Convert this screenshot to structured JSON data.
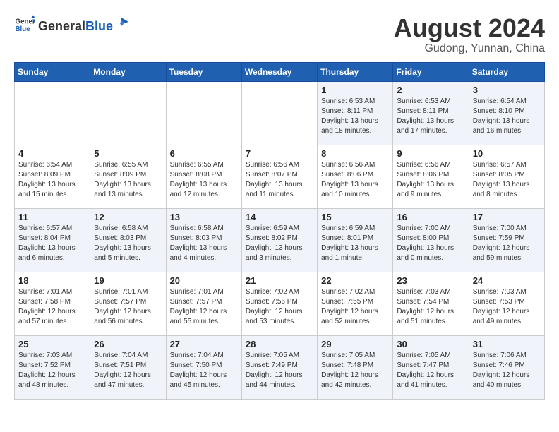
{
  "header": {
    "logo_general": "General",
    "logo_blue": "Blue",
    "title": "August 2024",
    "subtitle": "Gudong, Yunnan, China"
  },
  "days_of_week": [
    "Sunday",
    "Monday",
    "Tuesday",
    "Wednesday",
    "Thursday",
    "Friday",
    "Saturday"
  ],
  "weeks": [
    [
      {
        "day": "",
        "info": ""
      },
      {
        "day": "",
        "info": ""
      },
      {
        "day": "",
        "info": ""
      },
      {
        "day": "",
        "info": ""
      },
      {
        "day": "1",
        "info": "Sunrise: 6:53 AM\nSunset: 8:11 PM\nDaylight: 13 hours\nand 18 minutes."
      },
      {
        "day": "2",
        "info": "Sunrise: 6:53 AM\nSunset: 8:11 PM\nDaylight: 13 hours\nand 17 minutes."
      },
      {
        "day": "3",
        "info": "Sunrise: 6:54 AM\nSunset: 8:10 PM\nDaylight: 13 hours\nand 16 minutes."
      }
    ],
    [
      {
        "day": "4",
        "info": "Sunrise: 6:54 AM\nSunset: 8:09 PM\nDaylight: 13 hours\nand 15 minutes."
      },
      {
        "day": "5",
        "info": "Sunrise: 6:55 AM\nSunset: 8:09 PM\nDaylight: 13 hours\nand 13 minutes."
      },
      {
        "day": "6",
        "info": "Sunrise: 6:55 AM\nSunset: 8:08 PM\nDaylight: 13 hours\nand 12 minutes."
      },
      {
        "day": "7",
        "info": "Sunrise: 6:56 AM\nSunset: 8:07 PM\nDaylight: 13 hours\nand 11 minutes."
      },
      {
        "day": "8",
        "info": "Sunrise: 6:56 AM\nSunset: 8:06 PM\nDaylight: 13 hours\nand 10 minutes."
      },
      {
        "day": "9",
        "info": "Sunrise: 6:56 AM\nSunset: 8:06 PM\nDaylight: 13 hours\nand 9 minutes."
      },
      {
        "day": "10",
        "info": "Sunrise: 6:57 AM\nSunset: 8:05 PM\nDaylight: 13 hours\nand 8 minutes."
      }
    ],
    [
      {
        "day": "11",
        "info": "Sunrise: 6:57 AM\nSunset: 8:04 PM\nDaylight: 13 hours\nand 6 minutes."
      },
      {
        "day": "12",
        "info": "Sunrise: 6:58 AM\nSunset: 8:03 PM\nDaylight: 13 hours\nand 5 minutes."
      },
      {
        "day": "13",
        "info": "Sunrise: 6:58 AM\nSunset: 8:03 PM\nDaylight: 13 hours\nand 4 minutes."
      },
      {
        "day": "14",
        "info": "Sunrise: 6:59 AM\nSunset: 8:02 PM\nDaylight: 13 hours\nand 3 minutes."
      },
      {
        "day": "15",
        "info": "Sunrise: 6:59 AM\nSunset: 8:01 PM\nDaylight: 13 hours\nand 1 minute."
      },
      {
        "day": "16",
        "info": "Sunrise: 7:00 AM\nSunset: 8:00 PM\nDaylight: 13 hours\nand 0 minutes."
      },
      {
        "day": "17",
        "info": "Sunrise: 7:00 AM\nSunset: 7:59 PM\nDaylight: 12 hours\nand 59 minutes."
      }
    ],
    [
      {
        "day": "18",
        "info": "Sunrise: 7:01 AM\nSunset: 7:58 PM\nDaylight: 12 hours\nand 57 minutes."
      },
      {
        "day": "19",
        "info": "Sunrise: 7:01 AM\nSunset: 7:57 PM\nDaylight: 12 hours\nand 56 minutes."
      },
      {
        "day": "20",
        "info": "Sunrise: 7:01 AM\nSunset: 7:57 PM\nDaylight: 12 hours\nand 55 minutes."
      },
      {
        "day": "21",
        "info": "Sunrise: 7:02 AM\nSunset: 7:56 PM\nDaylight: 12 hours\nand 53 minutes."
      },
      {
        "day": "22",
        "info": "Sunrise: 7:02 AM\nSunset: 7:55 PM\nDaylight: 12 hours\nand 52 minutes."
      },
      {
        "day": "23",
        "info": "Sunrise: 7:03 AM\nSunset: 7:54 PM\nDaylight: 12 hours\nand 51 minutes."
      },
      {
        "day": "24",
        "info": "Sunrise: 7:03 AM\nSunset: 7:53 PM\nDaylight: 12 hours\nand 49 minutes."
      }
    ],
    [
      {
        "day": "25",
        "info": "Sunrise: 7:03 AM\nSunset: 7:52 PM\nDaylight: 12 hours\nand 48 minutes."
      },
      {
        "day": "26",
        "info": "Sunrise: 7:04 AM\nSunset: 7:51 PM\nDaylight: 12 hours\nand 47 minutes."
      },
      {
        "day": "27",
        "info": "Sunrise: 7:04 AM\nSunset: 7:50 PM\nDaylight: 12 hours\nand 45 minutes."
      },
      {
        "day": "28",
        "info": "Sunrise: 7:05 AM\nSunset: 7:49 PM\nDaylight: 12 hours\nand 44 minutes."
      },
      {
        "day": "29",
        "info": "Sunrise: 7:05 AM\nSunset: 7:48 PM\nDaylight: 12 hours\nand 42 minutes."
      },
      {
        "day": "30",
        "info": "Sunrise: 7:05 AM\nSunset: 7:47 PM\nDaylight: 12 hours\nand 41 minutes."
      },
      {
        "day": "31",
        "info": "Sunrise: 7:06 AM\nSunset: 7:46 PM\nDaylight: 12 hours\nand 40 minutes."
      }
    ]
  ]
}
